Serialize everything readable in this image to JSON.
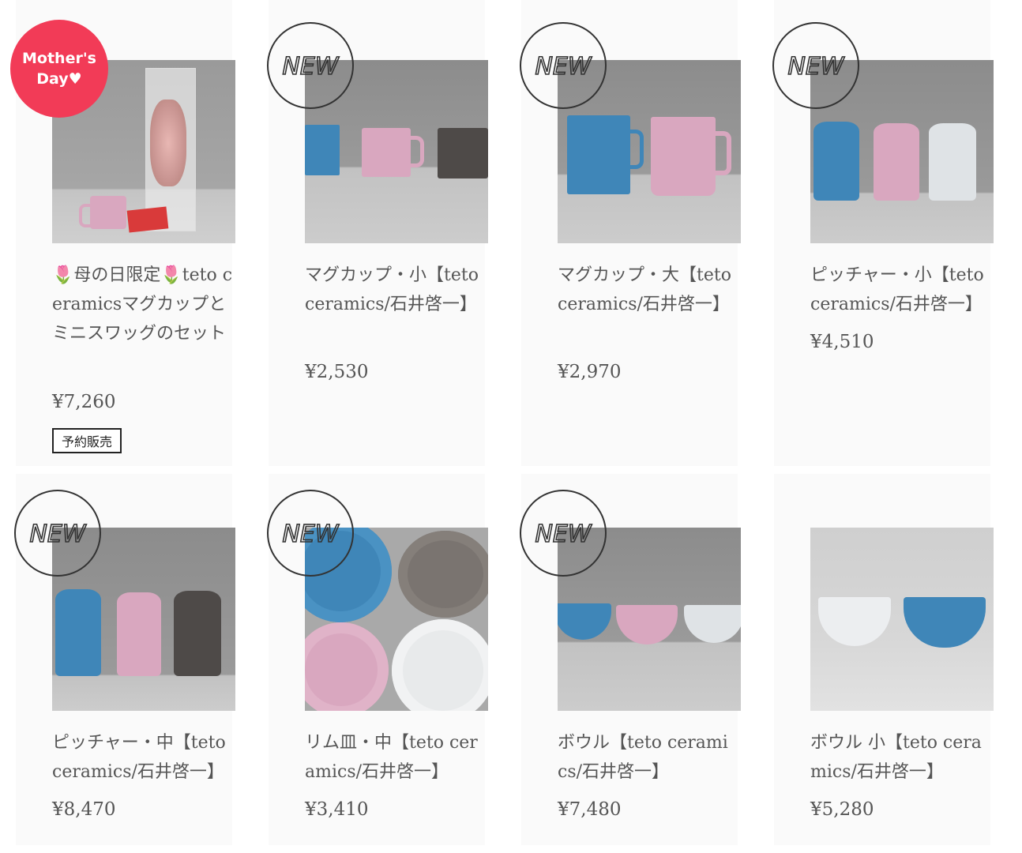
{
  "colors": {
    "mug_blue": "#3f86b8",
    "mug_pink": "#d9a7bf",
    "mug_dark": "#4e4a48",
    "mug_white": "#dfe3e6",
    "mothers_day_red": "#f23b57"
  },
  "badges": {
    "new_text": "NEW",
    "mothers_day_line1": "Mother's",
    "mothers_day_line2": "Day♥"
  },
  "products": [
    {
      "title": "🌷母の日限定🌷teto ceramicsマグカップとミニスワッグのセット",
      "price": "¥7,260",
      "tag": "予約販売",
      "badge": "mothers-day"
    },
    {
      "title": "マグカップ・小【teto ceramics/石井啓一】",
      "price": "¥2,530",
      "badge": "new"
    },
    {
      "title": "マグカップ・大【teto ceramics/石井啓一】",
      "price": "¥2,970",
      "badge": "new"
    },
    {
      "title": "ピッチャー・小【teto ceramics/石井啓一】",
      "price": "¥4,510",
      "badge": "new"
    },
    {
      "title": "ピッチャー・中【teto ceramics/石井啓一】",
      "price": "¥8,470",
      "badge": "new"
    },
    {
      "title": "リム皿・中【teto ceramics/石井啓一】",
      "price": "¥3,410",
      "badge": "new"
    },
    {
      "title": "ボウル【teto ceramics/石井啓一】",
      "price": "¥7,480",
      "badge": "new"
    },
    {
      "title": "ボウル 小【teto ceramics/石井啓一】",
      "price": "¥5,280",
      "badge": ""
    }
  ]
}
